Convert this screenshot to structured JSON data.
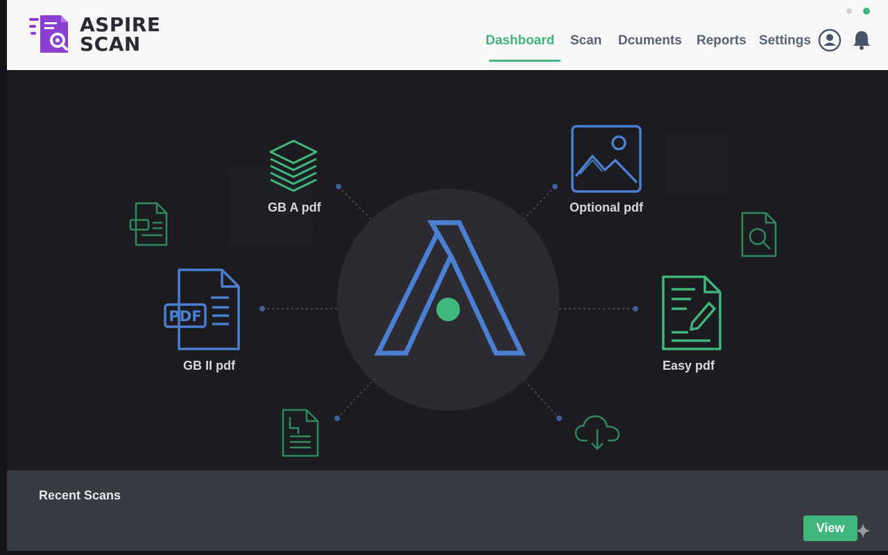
{
  "app": {
    "brand_line1": "ASPIRE",
    "brand_line2": "SCAN",
    "logo_icon": "scan-document-logo-icon"
  },
  "nav": {
    "items": [
      {
        "label": "Dashboard",
        "active": true
      },
      {
        "label": "Scan",
        "active": false
      },
      {
        "label": "Dcuments",
        "active": false
      },
      {
        "label": "Reports",
        "active": false
      },
      {
        "label": "Settings",
        "active": false
      }
    ],
    "icons": [
      "user-account-icon",
      "notification-bell-icon"
    ]
  },
  "hero": {
    "center_logo": "aspire-a-logo",
    "nodes": [
      {
        "label": "GB A pdf",
        "icon": "layers-stack-icon"
      },
      {
        "label": "Optional pdf",
        "icon": "image-file-icon"
      },
      {
        "label": "GB II pdf",
        "icon": "pdf-file-icon"
      },
      {
        "label": "Easy pdf",
        "icon": "edit-document-icon"
      }
    ],
    "small_icons": [
      "document-card-icon",
      "file-search-icon",
      "document-lines-icon",
      "cloud-download-icon"
    ]
  },
  "recent": {
    "title": "Recent Scans",
    "view_label": "View"
  },
  "colors": {
    "accent_green": "#3fb67c",
    "accent_blue": "#4a7fd1",
    "brand_purple": "#8a3fd1",
    "header_bg": "#f7f7f8",
    "hero_bg": "#1b1b20",
    "panel_bg": "#383b41"
  }
}
